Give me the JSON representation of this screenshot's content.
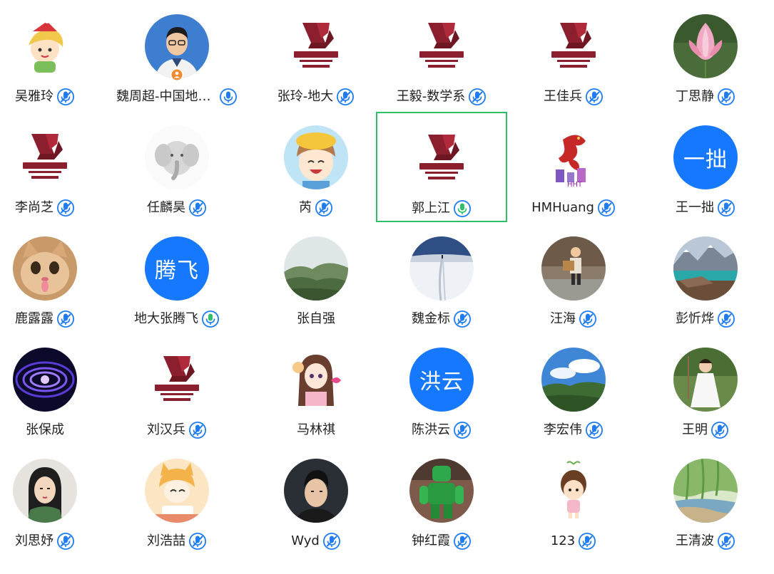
{
  "colors": {
    "accent_blue": "#1677ff",
    "mic_muted_fill": "#1f7cf2",
    "mic_speaking_green": "#2fbf6a",
    "active_border": "#2fbf6a",
    "host_orange": "#f28a2e",
    "university_red": "#8c1f2e"
  },
  "participants": [
    {
      "name": "吴雅玲",
      "mic": "muted",
      "avatar": "cartoon-girl-christmas"
    },
    {
      "name": "魏周超-中国地质...",
      "mic": "on",
      "avatar": "man-portrait",
      "host": true
    },
    {
      "name": "张玲-地大",
      "mic": "muted",
      "avatar": "university-logo"
    },
    {
      "name": "王毅-数学系",
      "mic": "muted",
      "avatar": "university-logo"
    },
    {
      "name": "王佳兵",
      "mic": "muted",
      "avatar": "university-logo"
    },
    {
      "name": "丁思静",
      "mic": "muted",
      "avatar": "lotus-flower"
    },
    {
      "name": "李尚芝",
      "mic": "muted",
      "avatar": "university-logo"
    },
    {
      "name": "任麟昊",
      "mic": "muted",
      "avatar": "elephant-sketch"
    },
    {
      "name": "芮",
      "mic": "muted",
      "avatar": "anime-kid-yellow-hat"
    },
    {
      "name": "郭上江",
      "mic": "speaking",
      "avatar": "university-logo",
      "active": true
    },
    {
      "name": "HMHuang",
      "mic": "muted",
      "avatar": "mulan-dragon"
    },
    {
      "name": "王一拙",
      "mic": "muted",
      "avatar": "initials",
      "initials": "一拙"
    },
    {
      "name": "鹿露露",
      "mic": "muted",
      "avatar": "cat-face"
    },
    {
      "name": "地大张腾飞",
      "mic": "unmuted",
      "avatar": "initials",
      "initials": "腾飞"
    },
    {
      "name": "张自强",
      "mic": "none",
      "avatar": "misty-hills"
    },
    {
      "name": "魏金标",
      "mic": "muted",
      "avatar": "snow-path"
    },
    {
      "name": "汪海",
      "mic": "muted",
      "avatar": "child-carrying-box"
    },
    {
      "name": "彭忻烨",
      "mic": "muted",
      "avatar": "mountain-lake"
    },
    {
      "name": "张保成",
      "mic": "none",
      "avatar": "purple-vortex"
    },
    {
      "name": "刘汉兵",
      "mic": "muted",
      "avatar": "university-logo"
    },
    {
      "name": "马林祺",
      "mic": "none",
      "avatar": "anime-girl-pink"
    },
    {
      "name": "陈洪云",
      "mic": "muted",
      "avatar": "initials",
      "initials": "洪云"
    },
    {
      "name": "李宏伟",
      "mic": "muted",
      "avatar": "sky-forest"
    },
    {
      "name": "王明",
      "mic": "muted",
      "avatar": "girl-white-dress"
    },
    {
      "name": "刘思妤",
      "mic": "muted",
      "avatar": "mulan-portrait"
    },
    {
      "name": "刘浩喆",
      "mic": "muted",
      "avatar": "cartoon-cat-girl"
    },
    {
      "name": "Wyd",
      "mic": "muted",
      "avatar": "man-dark-hair"
    },
    {
      "name": "钟红霞",
      "mic": "muted",
      "avatar": "green-robot-statue"
    },
    {
      "name": "123",
      "mic": "muted",
      "avatar": "cartoon-boy-sprout"
    },
    {
      "name": "王清波",
      "mic": "muted",
      "avatar": "willow-lake"
    }
  ]
}
